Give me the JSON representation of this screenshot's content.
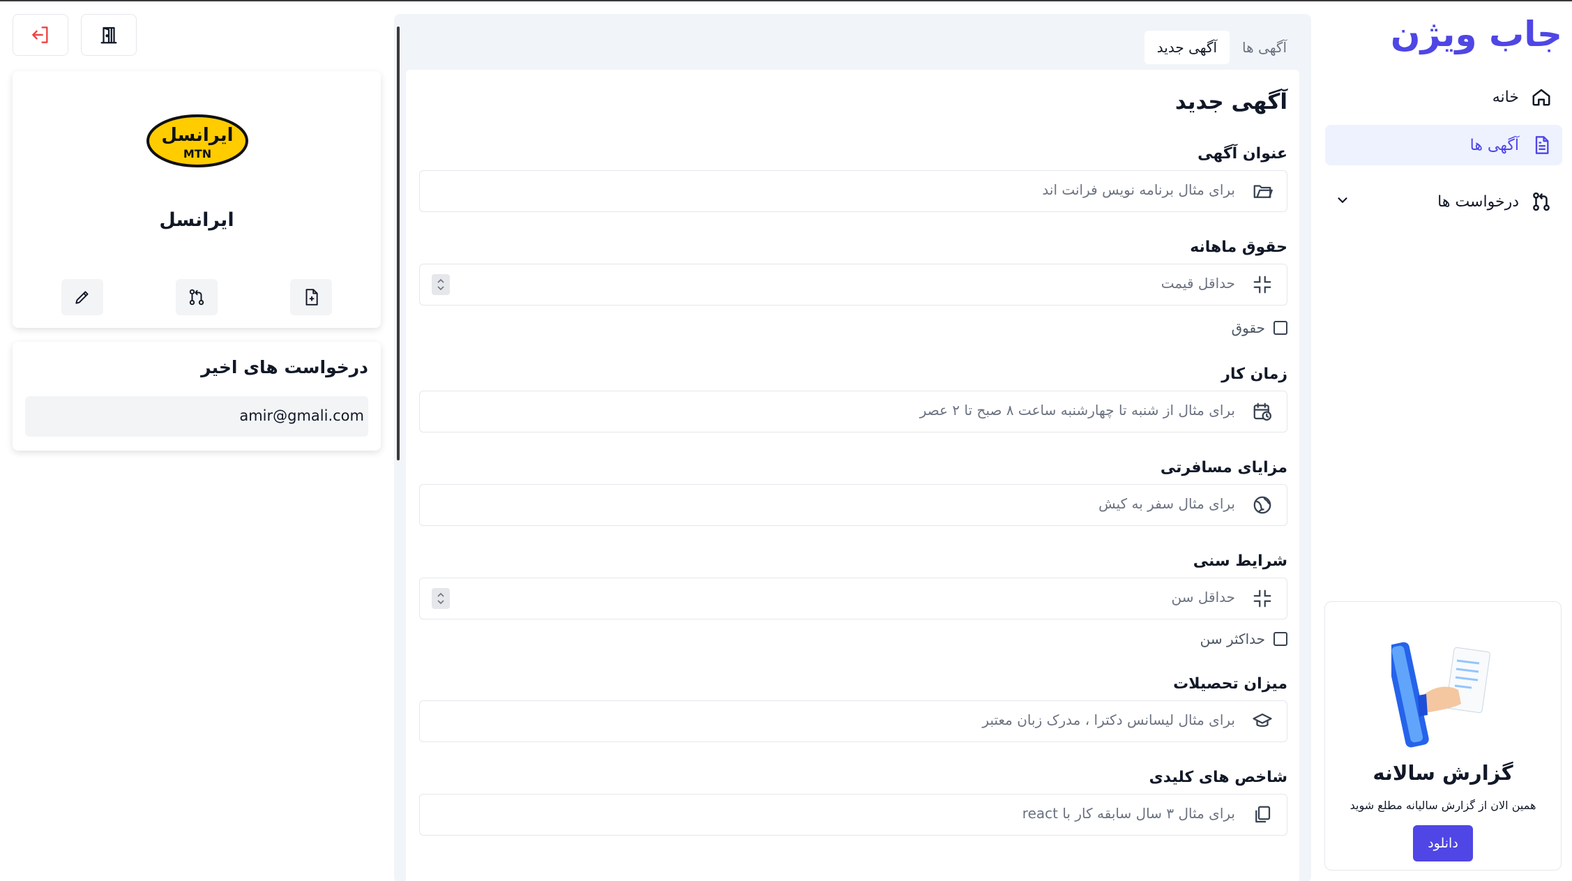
{
  "sidebar": {
    "logo": "جاب ویژن",
    "items": [
      {
        "label": "خانه",
        "icon": "home-icon"
      },
      {
        "label": "آگهی ها",
        "icon": "document-icon"
      },
      {
        "label": "درخواست ها",
        "icon": "pull-request-icon"
      }
    ],
    "accent_color": "#4f46e5"
  },
  "promo": {
    "title": "گزارش سالانه",
    "description": "همین الان از گزارش سالیانه مطلع شوید",
    "button": "دانلود"
  },
  "main": {
    "tabs": [
      {
        "label": "آگهی ها",
        "active": false
      },
      {
        "label": "آگهی جدید",
        "active": true
      }
    ],
    "form_title": "آگهی جدید",
    "fields": {
      "title": {
        "label": "عنوان آگهی",
        "placeholder": "برای مثال برنامه نویس فرانت اند",
        "icon": "folder-icon"
      },
      "salary": {
        "label": "حقوق ماهانه",
        "placeholder": "حداقل قیمت",
        "icon": "compress-icon",
        "checkbox": "حقوق"
      },
      "work_time": {
        "label": "زمان کار",
        "placeholder": "برای مثال از شنبه تا چهارشنبه ساعت ۸ صبح تا ۲ عصر",
        "icon": "calendar-clock-icon"
      },
      "travel": {
        "label": "مزایای مسافرتی",
        "placeholder": "برای مثال سفر به کیش",
        "icon": "globe-icon"
      },
      "age": {
        "label": "شرایط سنی",
        "placeholder": "حداقل سن",
        "icon": "compress-icon",
        "checkbox": "حداکثر سن"
      },
      "education": {
        "label": "میزان تحصیلات",
        "placeholder": "برای مثال لیسانس دکترا ، مدرک زبان معتبر",
        "icon": "graduation-cap-icon"
      },
      "kpi": {
        "label": "شاخص های کلیدی",
        "placeholder": "برای مثال ۳ سال سابقه کار با react",
        "icon": "copy-icon"
      }
    }
  },
  "company": {
    "logo_text": "ایرانسل",
    "logo_sub": "MTN",
    "name": "ایرانسل",
    "logo_color": "#ffcc00"
  },
  "recent": {
    "title": "درخواست های اخیر",
    "items": [
      "amir@gmali.com"
    ]
  }
}
